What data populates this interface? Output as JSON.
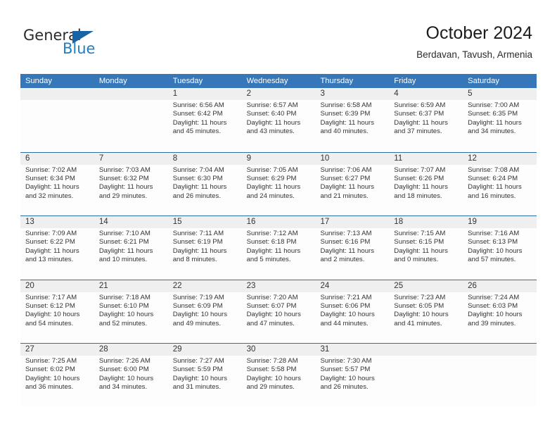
{
  "brand": {
    "name_part1": "General",
    "name_part2": "Blue",
    "accent_color": "#1f7fc4",
    "triangle_color": "#1763a6"
  },
  "header": {
    "title": "October 2024",
    "subtitle": "Berdavan, Tavush, Armenia"
  },
  "calendar": {
    "header_bg": "#3577b9",
    "row_border": "#2e6da8",
    "daynum_bg": "#efefef",
    "weekdays": [
      "Sunday",
      "Monday",
      "Tuesday",
      "Wednesday",
      "Thursday",
      "Friday",
      "Saturday"
    ],
    "weeks": [
      [
        {
          "day": "",
          "empty": true
        },
        {
          "day": "",
          "empty": true
        },
        {
          "day": "1",
          "sunrise": "Sunrise: 6:56 AM",
          "sunset": "Sunset: 6:42 PM",
          "daylight1": "Daylight: 11 hours",
          "daylight2": "and 45 minutes."
        },
        {
          "day": "2",
          "sunrise": "Sunrise: 6:57 AM",
          "sunset": "Sunset: 6:40 PM",
          "daylight1": "Daylight: 11 hours",
          "daylight2": "and 43 minutes."
        },
        {
          "day": "3",
          "sunrise": "Sunrise: 6:58 AM",
          "sunset": "Sunset: 6:39 PM",
          "daylight1": "Daylight: 11 hours",
          "daylight2": "and 40 minutes."
        },
        {
          "day": "4",
          "sunrise": "Sunrise: 6:59 AM",
          "sunset": "Sunset: 6:37 PM",
          "daylight1": "Daylight: 11 hours",
          "daylight2": "and 37 minutes."
        },
        {
          "day": "5",
          "sunrise": "Sunrise: 7:00 AM",
          "sunset": "Sunset: 6:35 PM",
          "daylight1": "Daylight: 11 hours",
          "daylight2": "and 34 minutes."
        }
      ],
      [
        {
          "day": "6",
          "sunrise": "Sunrise: 7:02 AM",
          "sunset": "Sunset: 6:34 PM",
          "daylight1": "Daylight: 11 hours",
          "daylight2": "and 32 minutes."
        },
        {
          "day": "7",
          "sunrise": "Sunrise: 7:03 AM",
          "sunset": "Sunset: 6:32 PM",
          "daylight1": "Daylight: 11 hours",
          "daylight2": "and 29 minutes."
        },
        {
          "day": "8",
          "sunrise": "Sunrise: 7:04 AM",
          "sunset": "Sunset: 6:30 PM",
          "daylight1": "Daylight: 11 hours",
          "daylight2": "and 26 minutes."
        },
        {
          "day": "9",
          "sunrise": "Sunrise: 7:05 AM",
          "sunset": "Sunset: 6:29 PM",
          "daylight1": "Daylight: 11 hours",
          "daylight2": "and 24 minutes."
        },
        {
          "day": "10",
          "sunrise": "Sunrise: 7:06 AM",
          "sunset": "Sunset: 6:27 PM",
          "daylight1": "Daylight: 11 hours",
          "daylight2": "and 21 minutes."
        },
        {
          "day": "11",
          "sunrise": "Sunrise: 7:07 AM",
          "sunset": "Sunset: 6:26 PM",
          "daylight1": "Daylight: 11 hours",
          "daylight2": "and 18 minutes."
        },
        {
          "day": "12",
          "sunrise": "Sunrise: 7:08 AM",
          "sunset": "Sunset: 6:24 PM",
          "daylight1": "Daylight: 11 hours",
          "daylight2": "and 16 minutes."
        }
      ],
      [
        {
          "day": "13",
          "sunrise": "Sunrise: 7:09 AM",
          "sunset": "Sunset: 6:22 PM",
          "daylight1": "Daylight: 11 hours",
          "daylight2": "and 13 minutes."
        },
        {
          "day": "14",
          "sunrise": "Sunrise: 7:10 AM",
          "sunset": "Sunset: 6:21 PM",
          "daylight1": "Daylight: 11 hours",
          "daylight2": "and 10 minutes."
        },
        {
          "day": "15",
          "sunrise": "Sunrise: 7:11 AM",
          "sunset": "Sunset: 6:19 PM",
          "daylight1": "Daylight: 11 hours",
          "daylight2": "and 8 minutes."
        },
        {
          "day": "16",
          "sunrise": "Sunrise: 7:12 AM",
          "sunset": "Sunset: 6:18 PM",
          "daylight1": "Daylight: 11 hours",
          "daylight2": "and 5 minutes."
        },
        {
          "day": "17",
          "sunrise": "Sunrise: 7:13 AM",
          "sunset": "Sunset: 6:16 PM",
          "daylight1": "Daylight: 11 hours",
          "daylight2": "and 2 minutes."
        },
        {
          "day": "18",
          "sunrise": "Sunrise: 7:15 AM",
          "sunset": "Sunset: 6:15 PM",
          "daylight1": "Daylight: 11 hours",
          "daylight2": "and 0 minutes."
        },
        {
          "day": "19",
          "sunrise": "Sunrise: 7:16 AM",
          "sunset": "Sunset: 6:13 PM",
          "daylight1": "Daylight: 10 hours",
          "daylight2": "and 57 minutes."
        }
      ],
      [
        {
          "day": "20",
          "sunrise": "Sunrise: 7:17 AM",
          "sunset": "Sunset: 6:12 PM",
          "daylight1": "Daylight: 10 hours",
          "daylight2": "and 54 minutes."
        },
        {
          "day": "21",
          "sunrise": "Sunrise: 7:18 AM",
          "sunset": "Sunset: 6:10 PM",
          "daylight1": "Daylight: 10 hours",
          "daylight2": "and 52 minutes."
        },
        {
          "day": "22",
          "sunrise": "Sunrise: 7:19 AM",
          "sunset": "Sunset: 6:09 PM",
          "daylight1": "Daylight: 10 hours",
          "daylight2": "and 49 minutes."
        },
        {
          "day": "23",
          "sunrise": "Sunrise: 7:20 AM",
          "sunset": "Sunset: 6:07 PM",
          "daylight1": "Daylight: 10 hours",
          "daylight2": "and 47 minutes."
        },
        {
          "day": "24",
          "sunrise": "Sunrise: 7:21 AM",
          "sunset": "Sunset: 6:06 PM",
          "daylight1": "Daylight: 10 hours",
          "daylight2": "and 44 minutes."
        },
        {
          "day": "25",
          "sunrise": "Sunrise: 7:23 AM",
          "sunset": "Sunset: 6:05 PM",
          "daylight1": "Daylight: 10 hours",
          "daylight2": "and 41 minutes."
        },
        {
          "day": "26",
          "sunrise": "Sunrise: 7:24 AM",
          "sunset": "Sunset: 6:03 PM",
          "daylight1": "Daylight: 10 hours",
          "daylight2": "and 39 minutes."
        }
      ],
      [
        {
          "day": "27",
          "sunrise": "Sunrise: 7:25 AM",
          "sunset": "Sunset: 6:02 PM",
          "daylight1": "Daylight: 10 hours",
          "daylight2": "and 36 minutes."
        },
        {
          "day": "28",
          "sunrise": "Sunrise: 7:26 AM",
          "sunset": "Sunset: 6:00 PM",
          "daylight1": "Daylight: 10 hours",
          "daylight2": "and 34 minutes."
        },
        {
          "day": "29",
          "sunrise": "Sunrise: 7:27 AM",
          "sunset": "Sunset: 5:59 PM",
          "daylight1": "Daylight: 10 hours",
          "daylight2": "and 31 minutes."
        },
        {
          "day": "30",
          "sunrise": "Sunrise: 7:28 AM",
          "sunset": "Sunset: 5:58 PM",
          "daylight1": "Daylight: 10 hours",
          "daylight2": "and 29 minutes."
        },
        {
          "day": "31",
          "sunrise": "Sunrise: 7:30 AM",
          "sunset": "Sunset: 5:57 PM",
          "daylight1": "Daylight: 10 hours",
          "daylight2": "and 26 minutes."
        },
        {
          "day": "",
          "empty": true
        },
        {
          "day": "",
          "empty": true
        }
      ]
    ]
  }
}
